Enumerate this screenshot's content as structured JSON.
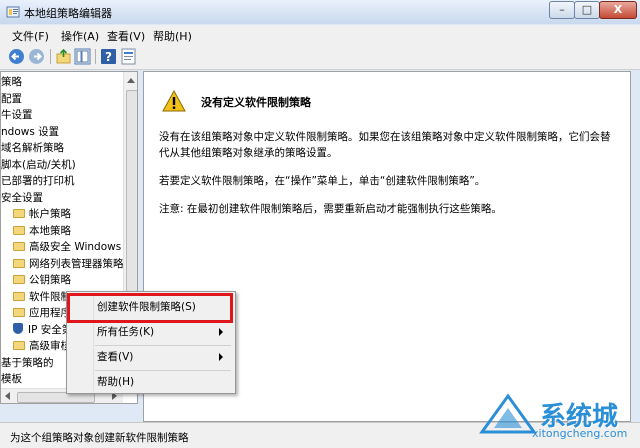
{
  "window": {
    "title": "本地组策略编辑器",
    "controls": {
      "minimize": "–",
      "maximize": "□",
      "close": "X"
    }
  },
  "menubar": [
    "文件(F)",
    "操作(A)",
    "查看(V)",
    "帮助(H)"
  ],
  "toolbar": {
    "icons": [
      "back-arrow-icon",
      "forward-arrow-icon",
      "up-folder-icon",
      "show-tree-icon",
      "help-icon",
      "properties-icon"
    ]
  },
  "tree": {
    "items": [
      {
        "label": "策略",
        "icon": "none"
      },
      {
        "label": "配置",
        "icon": "none"
      },
      {
        "label": "牛设置",
        "icon": "none"
      },
      {
        "label": "ndows 设置",
        "icon": "none"
      },
      {
        "label": "域名解析策略",
        "icon": "none"
      },
      {
        "label": "脚本(启动/关机)",
        "icon": "none"
      },
      {
        "label": "已部署的打印机",
        "icon": "none"
      },
      {
        "label": "安全设置",
        "icon": "none"
      },
      {
        "label": "帐户策略",
        "icon": "folder"
      },
      {
        "label": "本地策略",
        "icon": "folder"
      },
      {
        "label": "高级安全 Windows I",
        "icon": "folder"
      },
      {
        "label": "网络列表管理器策略",
        "icon": "folder"
      },
      {
        "label": "公钥策略",
        "icon": "folder"
      },
      {
        "label": "软件限制",
        "icon": "folder"
      },
      {
        "label": "应用程序",
        "icon": "folder"
      },
      {
        "label": "IP 安全第",
        "icon": "shield"
      },
      {
        "label": "高级审核",
        "icon": "folder"
      },
      {
        "label": "基于策略的",
        "icon": "none"
      },
      {
        "label": "模板",
        "icon": "none"
      }
    ]
  },
  "content": {
    "heading": "没有定义软件限制策略",
    "para1": "没有在该组策略对象中定义软件限制策略。如果您在该组策略对象中定义软件限制策略，它们会替代从其他组策略对象继承的策略设置。",
    "para2": "若要定义软件限制策略，在“操作”菜单上，单击“创建软件限制策略”。",
    "para3": "注意: 在最初创建软件限制策略后，需要重新启动才能强制执行这些策略。"
  },
  "context_menu": {
    "items": [
      {
        "label": "创建软件限制策略(S)",
        "submenu": false
      },
      {
        "label": "所有任务(K)",
        "submenu": true
      },
      {
        "label": "查看(V)",
        "submenu": true
      },
      {
        "label": "帮助(H)",
        "submenu": false
      }
    ]
  },
  "statusbar": {
    "text": "为这个组策略对象创建新软件限制策略"
  },
  "watermark": {
    "text": "系统城",
    "url": "xitongcheng.com"
  },
  "colors": {
    "highlight_box": "#e0161c",
    "watermark": "#2a8fd6"
  }
}
